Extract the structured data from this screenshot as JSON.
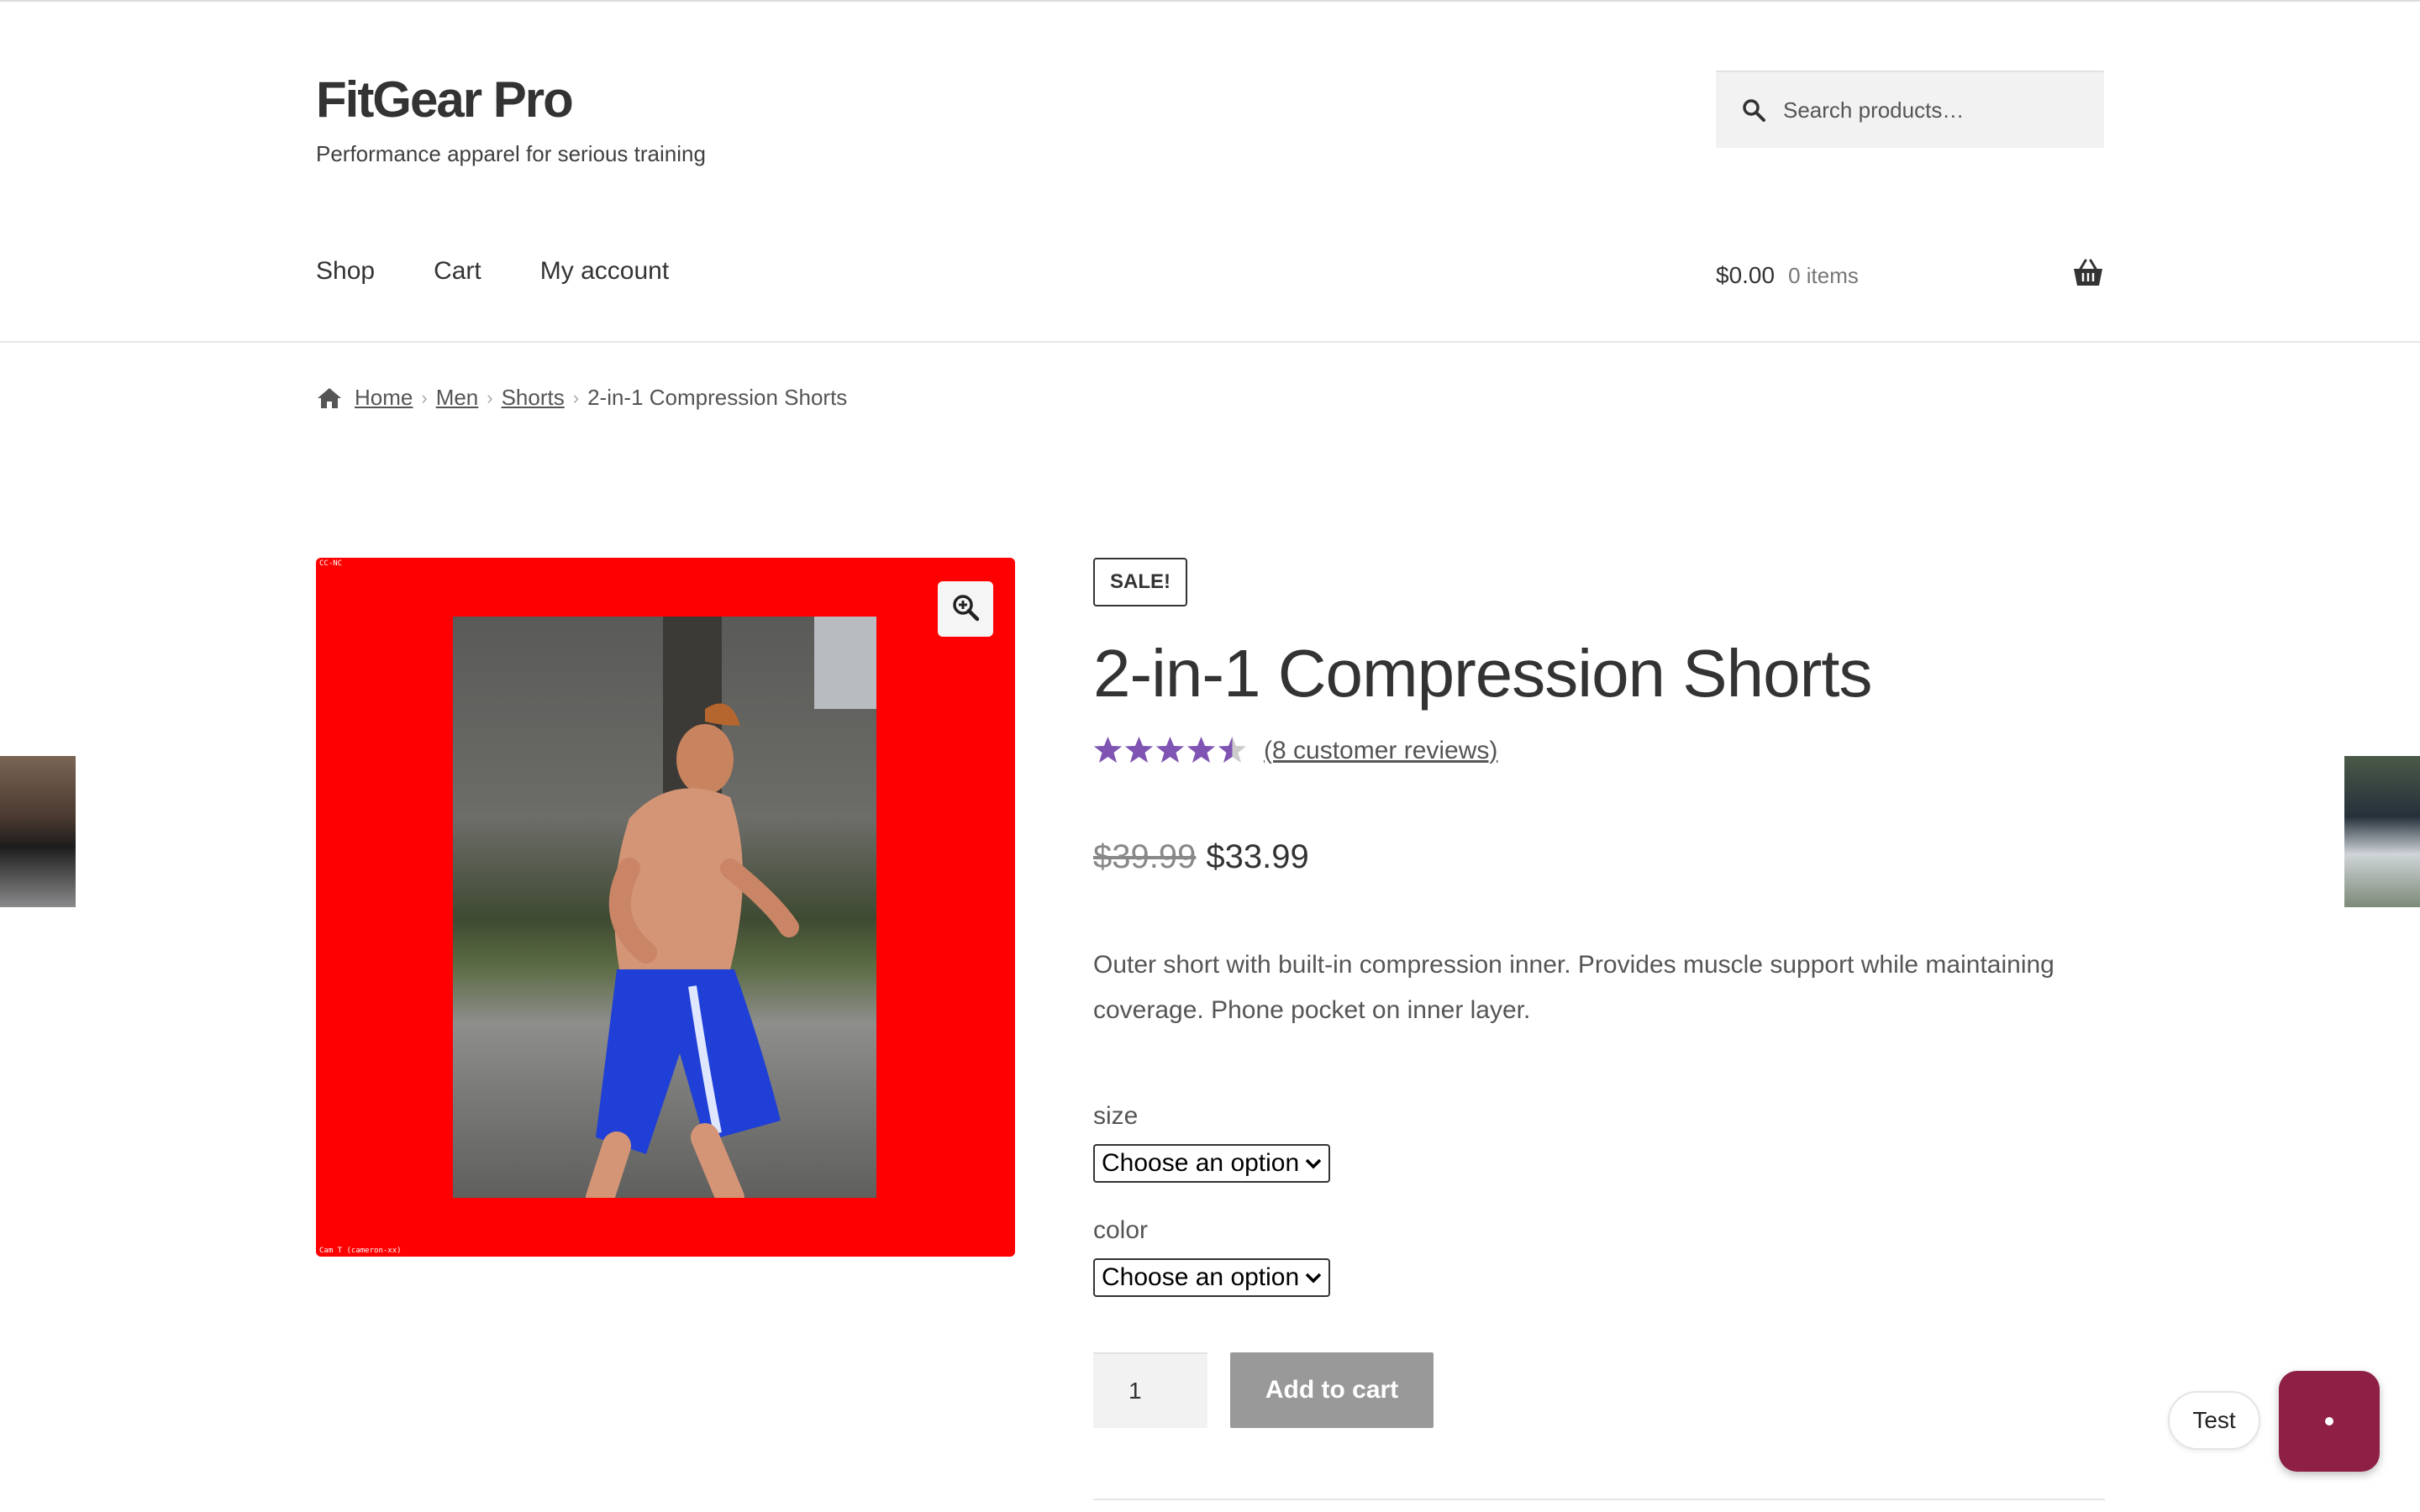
{
  "site": {
    "title": "FitGear Pro",
    "tagline": "Performance apparel for serious training"
  },
  "search": {
    "placeholder": "Search products…",
    "icon": "search-icon"
  },
  "nav": {
    "items": [
      {
        "label": "Shop"
      },
      {
        "label": "Cart"
      },
      {
        "label": "My account"
      }
    ]
  },
  "cart": {
    "amount": "$0.00",
    "count": "0 items",
    "icon": "basket-icon"
  },
  "breadcrumb": {
    "items": [
      "Home",
      "Men",
      "Shorts"
    ],
    "current": "2-in-1 Compression Shorts"
  },
  "gallery": {
    "credit_top": "CC-NC",
    "credit_bottom": "Cam T (cameron-xx)"
  },
  "product": {
    "badge": "SALE!",
    "title": "2-in-1 Compression Shorts",
    "rating": 4.5,
    "rating_max": 5,
    "reviews_link": "(8 customer reviews)",
    "price_old": "$39.99",
    "price_new": "$33.99",
    "description": "Outer short with built-in compression inner. Provides muscle support while maintaining coverage. Phone pocket on inner layer.",
    "size": {
      "label": "size",
      "selected": "Choose an option"
    },
    "color": {
      "label": "color",
      "selected": "Choose an option"
    },
    "quantity": "1",
    "add_to_cart": "Add to cart"
  },
  "widgets": {
    "test_label": "Test"
  },
  "colors": {
    "star": "#7f54b3",
    "star_empty": "#cccccc",
    "button_disabled": "#999999",
    "chat_button": "#8e1f45",
    "gallery_bg": "#ff0000"
  }
}
